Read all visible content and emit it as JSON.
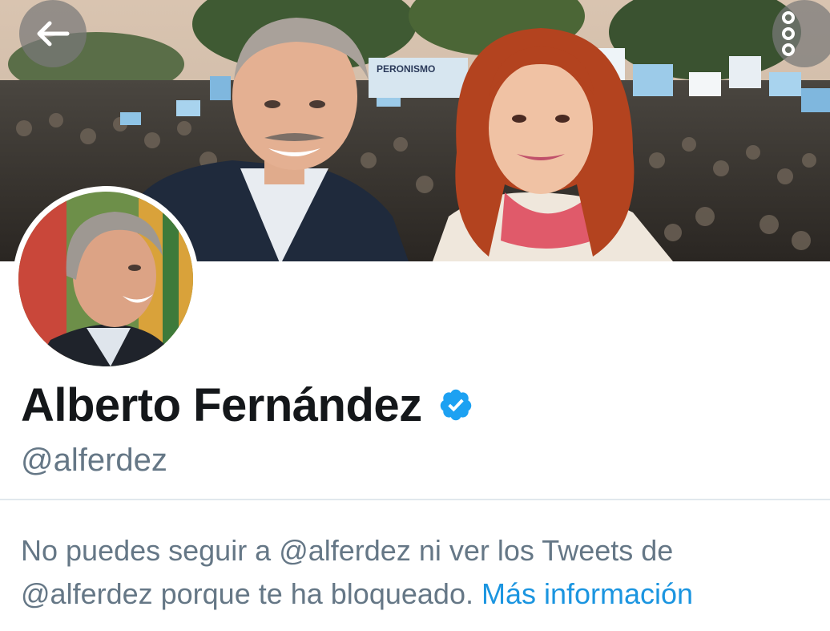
{
  "header": {
    "back_icon": "arrow-left-icon",
    "more_icon": "vertical-dots-icon",
    "banner_sign_text": "PERONISMO"
  },
  "profile": {
    "name": "Alberto Fernández",
    "verified_icon": "verified-badge-icon",
    "handle": "@alferdez"
  },
  "blocked_notice": {
    "text_line1": "No puedes seguir a @alferdez ni ver los Tweets de",
    "text_line2": "@alferdez porque te ha bloqueado. ",
    "link": "Más información"
  },
  "colors": {
    "accent": "#1b95e0",
    "verified": "#1da1f2",
    "name": "#14171a",
    "secondary": "#657786",
    "divider": "#e1e8ed"
  }
}
